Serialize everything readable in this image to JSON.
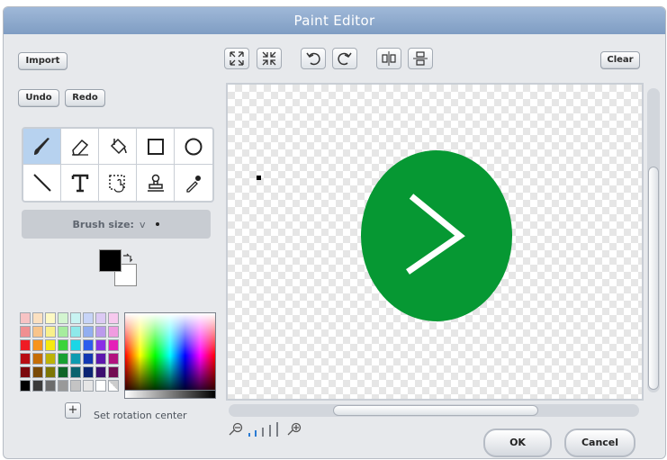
{
  "window": {
    "title": "Paint Editor"
  },
  "buttons": {
    "import": "Import",
    "clear": "Clear",
    "undo": "Undo",
    "redo": "Redo",
    "ok": "OK",
    "cancel": "Cancel"
  },
  "toolbar_icons": [
    "zoom-in-full-icon",
    "shrink-icon",
    "undo-icon",
    "redo-icon",
    "flip-horizontal-icon",
    "flip-vertical-icon"
  ],
  "tools": [
    {
      "name": "brush-tool",
      "selected": true
    },
    {
      "name": "eraser-tool"
    },
    {
      "name": "fill-tool"
    },
    {
      "name": "rectangle-tool"
    },
    {
      "name": "ellipse-tool"
    },
    {
      "name": "line-tool"
    },
    {
      "name": "text-tool"
    },
    {
      "name": "select-tool"
    },
    {
      "name": "stamp-tool"
    },
    {
      "name": "eyedropper-tool"
    }
  ],
  "brush": {
    "label": "Brush size:",
    "chevron": "v"
  },
  "colors": {
    "foreground": "#000000",
    "background": "#ffffff",
    "accent": "#069833"
  },
  "rotation": {
    "label": "Set rotation center",
    "icon": "+"
  }
}
